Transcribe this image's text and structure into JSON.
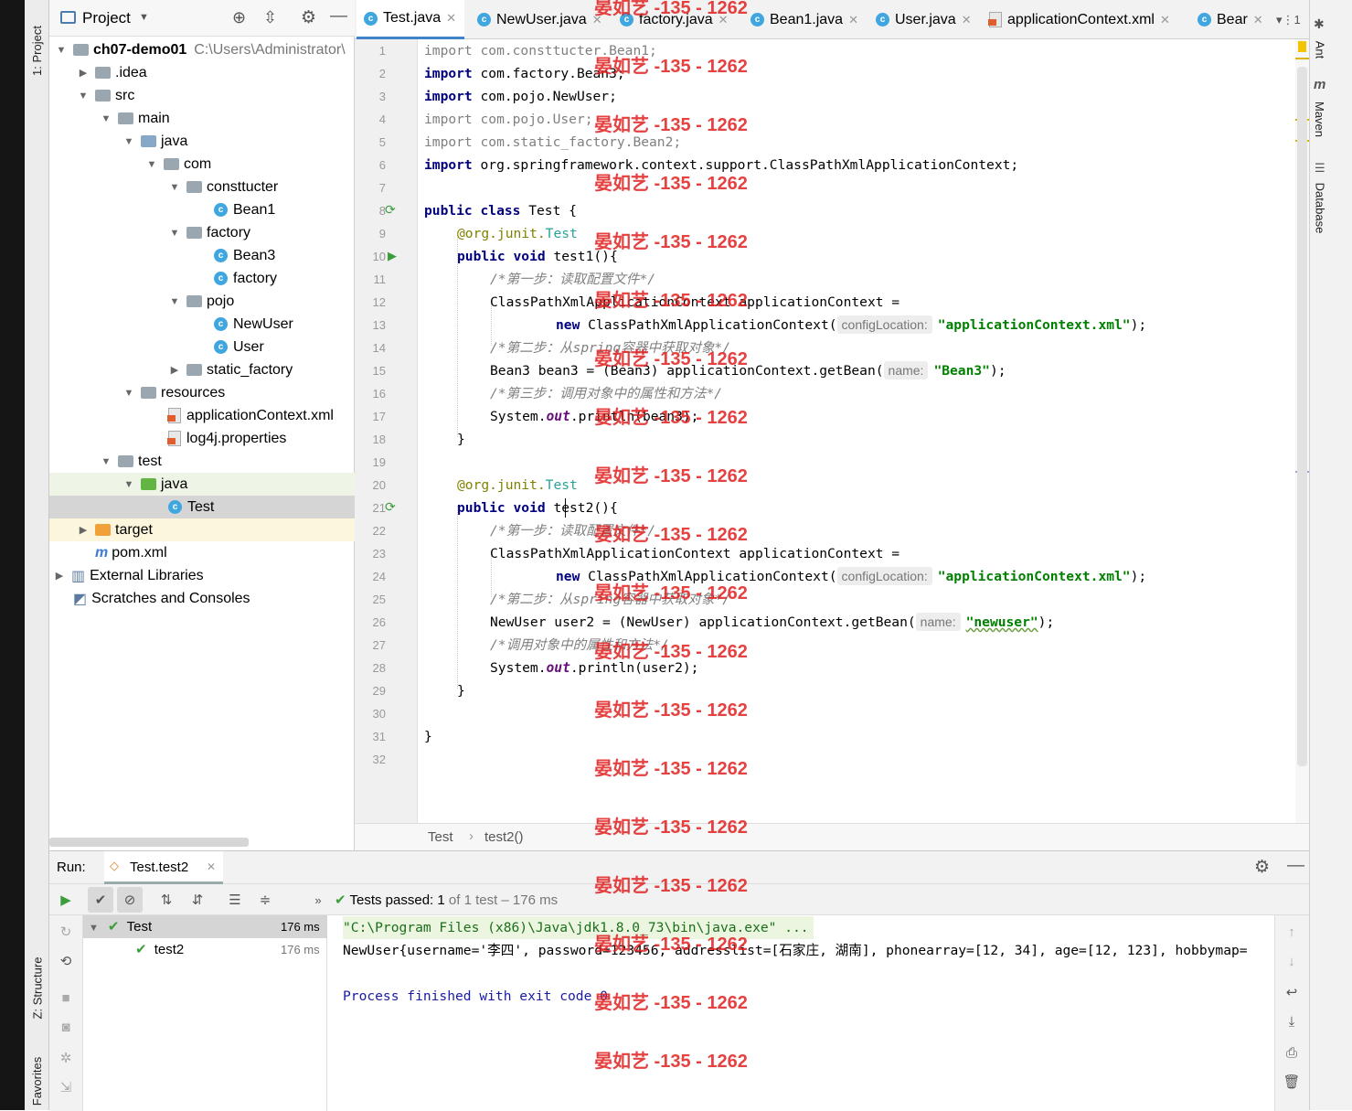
{
  "left_tabs": {
    "project": "1: Project",
    "structure": "Z: Structure",
    "favorites": "Favorites"
  },
  "right_tabs": {
    "ant": "Ant",
    "maven": "Maven",
    "database": "Database"
  },
  "project_panel": {
    "title": "Project",
    "tree": [
      {
        "label": "ch07-demo01",
        "path_hint": "C:\\Users\\Administrator\\",
        "bold": true
      },
      {
        "label": ".idea"
      },
      {
        "label": "src"
      },
      {
        "label": "main"
      },
      {
        "label": "java"
      },
      {
        "label": "com"
      },
      {
        "label": "consttucter"
      },
      {
        "label": "Bean1"
      },
      {
        "label": "factory"
      },
      {
        "label": "Bean3"
      },
      {
        "label": "factory"
      },
      {
        "label": "pojo"
      },
      {
        "label": "NewUser"
      },
      {
        "label": "User"
      },
      {
        "label": "static_factory"
      },
      {
        "label": "resources"
      },
      {
        "label": "applicationContext.xml"
      },
      {
        "label": "log4j.properties"
      },
      {
        "label": "test"
      },
      {
        "label": "java"
      },
      {
        "label": "Test"
      },
      {
        "label": "target"
      },
      {
        "label": "pom.xml"
      },
      {
        "label": "External Libraries"
      },
      {
        "label": "Scratches and Consoles"
      }
    ]
  },
  "editor_tabs": [
    {
      "label": "Test.java",
      "active": true
    },
    {
      "label": "NewUser.java"
    },
    {
      "label": "factory.java"
    },
    {
      "label": "Bean1.java"
    },
    {
      "label": "User.java"
    },
    {
      "label": "applicationContext.xml"
    },
    {
      "label": "Bear"
    }
  ],
  "tab_overflow": "▾⋮1",
  "line_numbers": [
    "1",
    "2",
    "3",
    "4",
    "5",
    "6",
    "7",
    "8",
    "9",
    "10",
    "11",
    "12",
    "13",
    "14",
    "15",
    "16",
    "17",
    "18",
    "19",
    "20",
    "21",
    "22",
    "23",
    "24",
    "25",
    "26",
    "27",
    "28",
    "29",
    "30",
    "31",
    "32"
  ],
  "code": {
    "l1_kw": "import",
    "l1": " com.consttucter.Bean1;",
    "l2_kw": "import",
    "l2": " com.factory.Bean3;",
    "l3_kw": "import",
    "l3": " com.pojo.NewUser;",
    "l4_kw": "import",
    "l4": " com.pojo.User;",
    "l5_kw": "import",
    "l5": " com.static_factory.Bean2;",
    "l6_kw": "import",
    "l6": " org.springframework.context.support.ClassPathXmlApplicationContext;",
    "l8_kw": "public class",
    "l8": " Test {",
    "l9_a": "@org.junit.",
    "l9_b": "Test",
    "l10_kw": "public void",
    "l10": " test1(){",
    "l11": "/*第一步：读取配置文件*/",
    "l12": "ClassPathXmlApplicationContext applicationContext =",
    "l13_kw": "new",
    "l13": " ClassPathXmlApplicationContext(",
    "l13_hint": "configLocation:",
    "l13_str": "\"applicationContext.xml\"",
    "l13_end": ");",
    "l14": "/*第二步：从spring容器中获取对象*/",
    "l15": "Bean3 bean3 = (Bean3) applicationContext.getBean(",
    "l15_hint": "name:",
    "l15_str": "\"Bean3\"",
    "l15_end": ");",
    "l16": "/*第三步：调用对象中的属性和方法*/",
    "l17_a": "System.",
    "l17_f": "out",
    "l17_b": ".println(bean3);",
    "l18": "}",
    "l20_a": "@org.junit.",
    "l20_b": "Test",
    "l21_kw": "public void",
    "l21": " test2(){",
    "l22": "/*第一步：读取配置文件*/",
    "l23": "ClassPathXmlApplicationContext applicationContext =",
    "l24_kw": "new",
    "l24": " ClassPathXmlApplicationContext(",
    "l24_hint": "configLocation:",
    "l24_str": "\"applicationContext.xml\"",
    "l24_end": ");",
    "l25": "/*第二步：从spring容器中获取对象*/",
    "l26": "NewUser user2 = (NewUser) applicationContext.getBean(",
    "l26_hint": "name:",
    "l26_str": "\"newuser\"",
    "l26_end": ");",
    "l27": "/*调用对象中的属性和方法*/",
    "l28_a": "System.",
    "l28_f": "out",
    "l28_b": ".println(user2);",
    "l29": "}",
    "l31": "}"
  },
  "breadcrumb": {
    "class": "Test",
    "sep": "›",
    "method": "test2()"
  },
  "run_panel": {
    "label": "Run:",
    "config": "Test.test2",
    "status_prefix": "Tests passed:",
    "status_count": "1",
    "status_rest": "of 1 test – 176 ms",
    "tree": [
      {
        "name": "Test",
        "time": "176 ms"
      },
      {
        "name": "test2",
        "time": "176 ms"
      }
    ],
    "console": [
      "\"C:\\Program Files (x86)\\Java\\jdk1.8.0_73\\bin\\java.exe\" ...",
      "NewUser{username='李四', password=123456, addresslist=[石家庄, 湖南], phonearray=[12, 34], age=[12, 123], hobbymap=",
      "",
      "Process finished with exit code 0"
    ]
  },
  "watermark": "晏如艺 -135 - 1262"
}
